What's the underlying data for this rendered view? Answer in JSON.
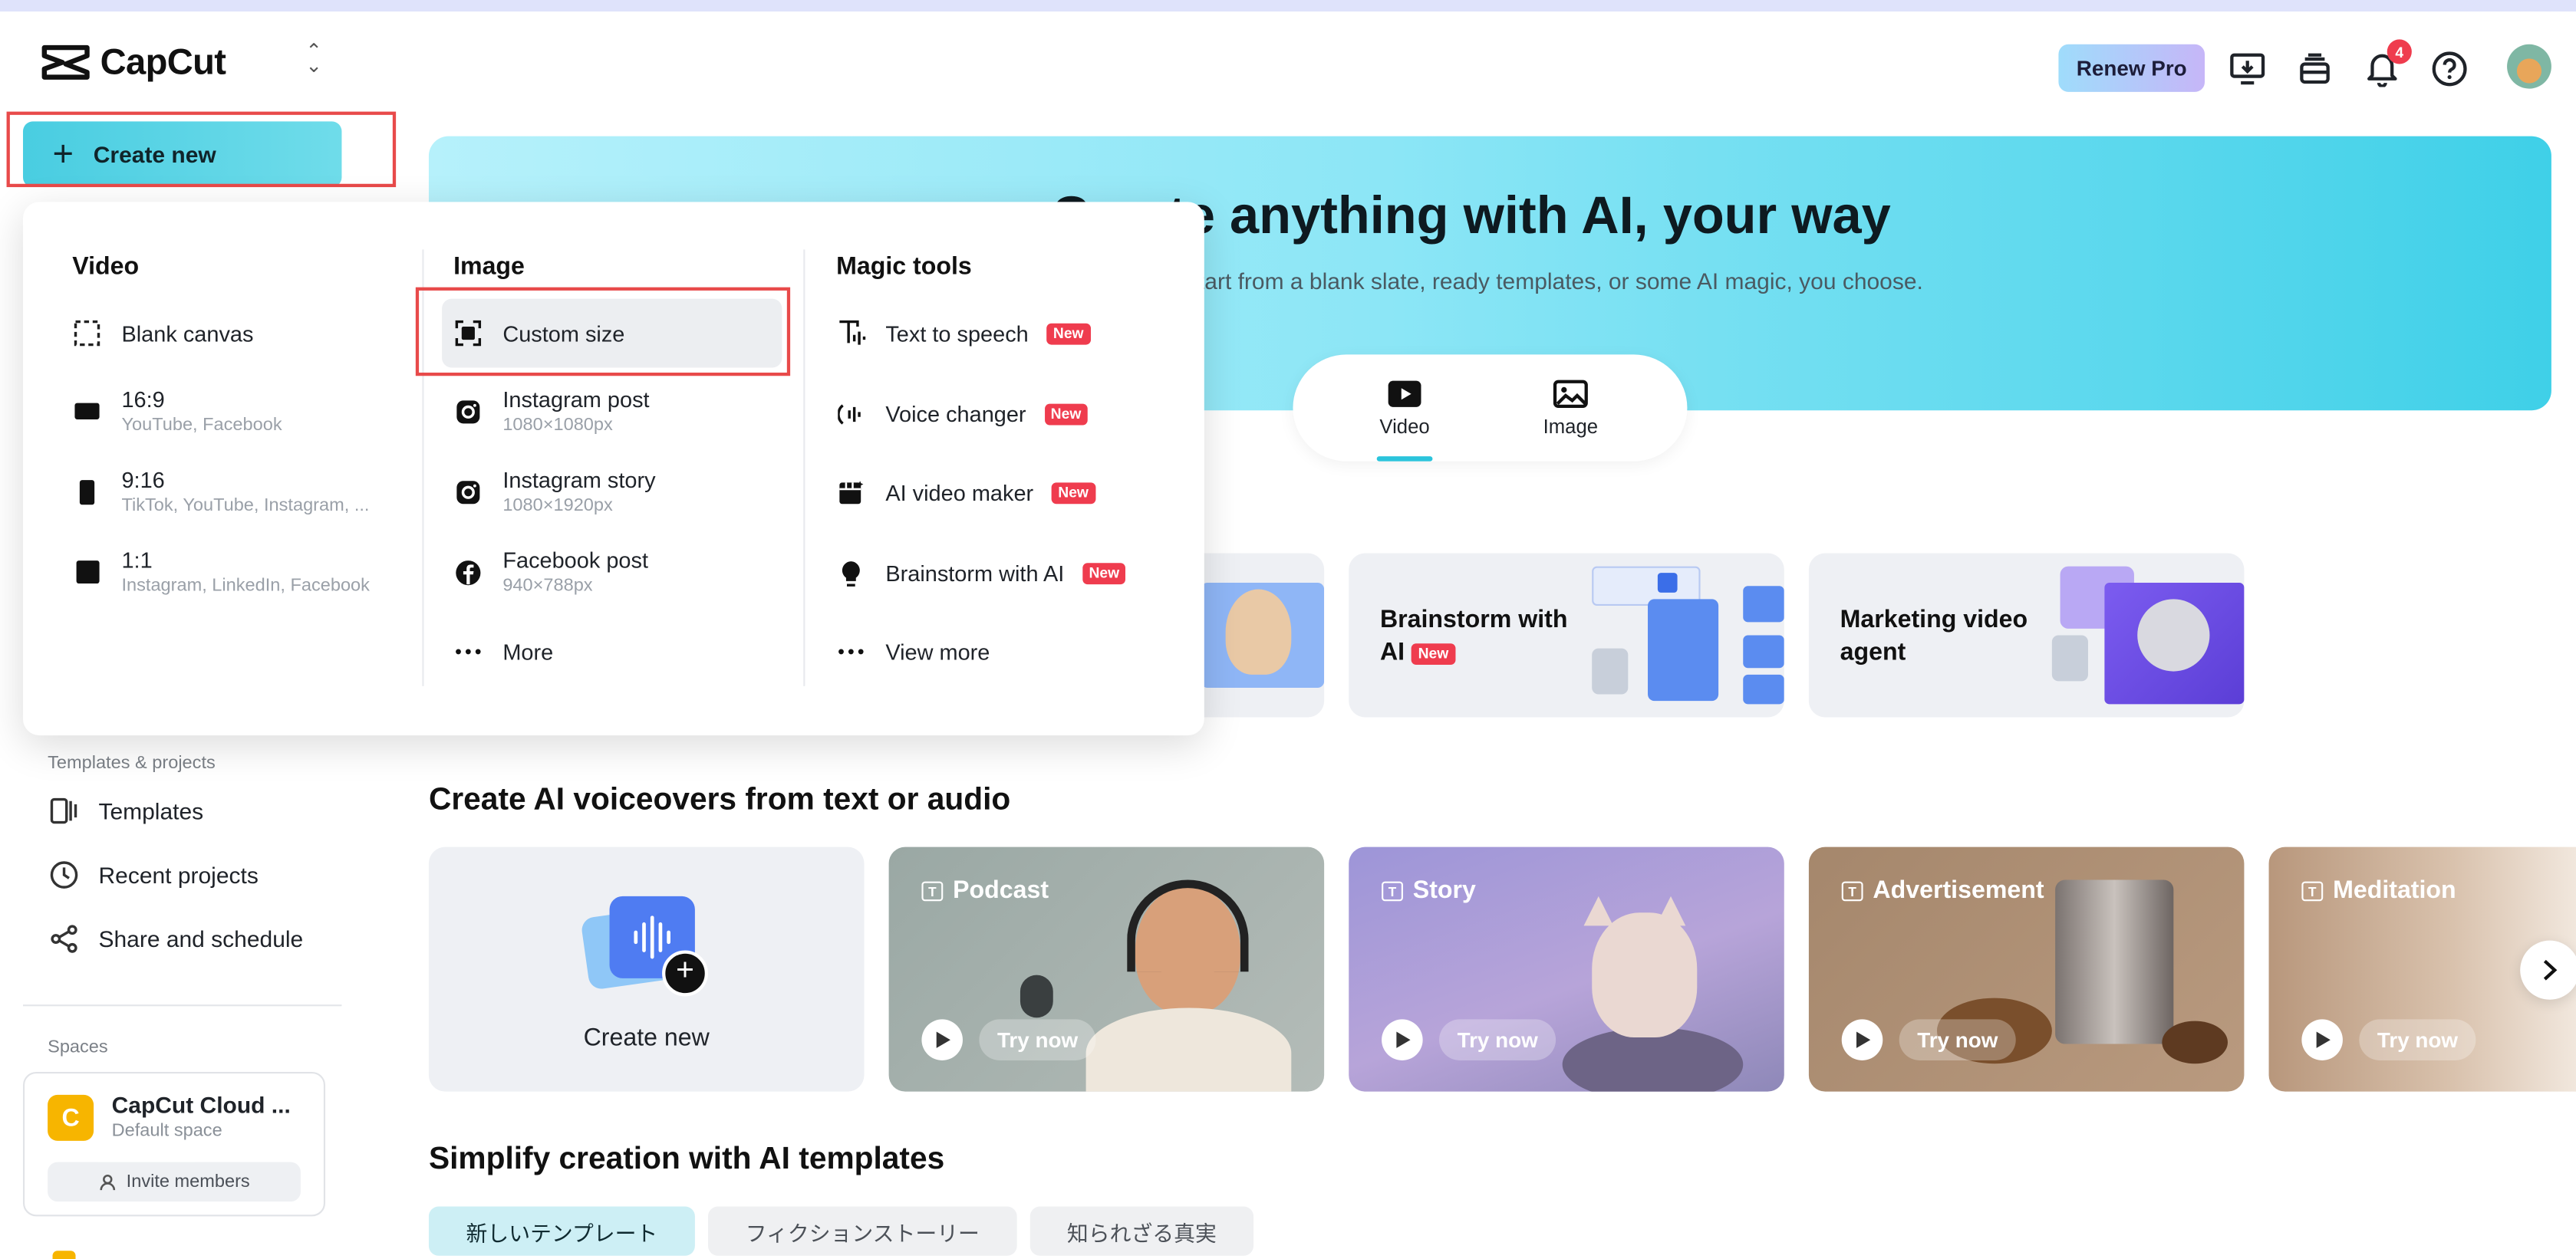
{
  "header": {
    "app_name": "CapCut",
    "renew_label": "Renew Pro",
    "notification_count": "4",
    "icons": [
      "desktop-download-icon",
      "layers-icon",
      "bell-icon",
      "help-icon"
    ]
  },
  "sidebar": {
    "create_new_label": "Create new",
    "templates_section": "Templates & projects",
    "items": [
      {
        "label": "Templates",
        "icon": "templates-icon"
      },
      {
        "label": "Recent projects",
        "icon": "clock-icon"
      },
      {
        "label": "Share and schedule",
        "icon": "share-icon"
      }
    ],
    "spaces_section": "Spaces",
    "space": {
      "logo_letter": "C",
      "name": "CapCut Cloud ...",
      "subtitle": "Default space",
      "invite_label": "Invite members"
    }
  },
  "hero": {
    "title": "Create anything with AI, your way",
    "subtitle": "Start from a blank slate, ready templates, or some AI magic, you choose.",
    "tabs": [
      {
        "label": "Video",
        "active": true
      },
      {
        "label": "Image",
        "active": false
      }
    ]
  },
  "feature_cards": [
    {
      "title": "Brainstorm with",
      "title2": "AI",
      "badge": "New"
    },
    {
      "title": "Marketing video",
      "title2": "agent",
      "badge": ""
    }
  ],
  "voiceovers": {
    "title": "Create AI voiceovers from text or audio",
    "create_label": "Create new",
    "cards": [
      {
        "label": "Podcast",
        "try": "Try now",
        "color": "#a9b4b0"
      },
      {
        "label": "Story",
        "try": "Try now",
        "color": "#a89bd6"
      },
      {
        "label": "Advertisement",
        "try": "Try now",
        "color": "#a88a70"
      },
      {
        "label": "Meditation",
        "try": "Try now",
        "color": "#c9a88d"
      }
    ]
  },
  "templates": {
    "title": "Simplify creation with AI templates",
    "chips": [
      {
        "label": "新しいテンプレート",
        "active": true
      },
      {
        "label": "フィクションストーリー",
        "active": false
      },
      {
        "label": "知られざる真実",
        "active": false
      }
    ]
  },
  "dropdown": {
    "video": {
      "title": "Video",
      "items": [
        {
          "label": "Blank canvas",
          "sub": ""
        },
        {
          "label": "16:9",
          "sub": "YouTube, Facebook"
        },
        {
          "label": "9:16",
          "sub": "TikTok, YouTube, Instagram, ..."
        },
        {
          "label": "1:1",
          "sub": "Instagram, LinkedIn, Facebook"
        }
      ]
    },
    "image": {
      "title": "Image",
      "items": [
        {
          "label": "Custom size",
          "sub": ""
        },
        {
          "label": "Instagram post",
          "sub": "1080×1080px"
        },
        {
          "label": "Instagram story",
          "sub": "1080×1920px"
        },
        {
          "label": "Facebook post",
          "sub": "940×788px"
        },
        {
          "label": "More",
          "sub": ""
        }
      ]
    },
    "magic": {
      "title": "Magic tools",
      "items": [
        {
          "label": "Text to speech",
          "badge": "New"
        },
        {
          "label": "Voice changer",
          "badge": "New"
        },
        {
          "label": "AI video maker",
          "badge": "New"
        },
        {
          "label": "Brainstorm with AI",
          "badge": "New"
        },
        {
          "label": "View more",
          "badge": ""
        }
      ]
    }
  },
  "colors": {
    "accent": "#2bc4dc",
    "new_badge": "#ef3c4e",
    "highlight_box": "#e84a4a"
  }
}
